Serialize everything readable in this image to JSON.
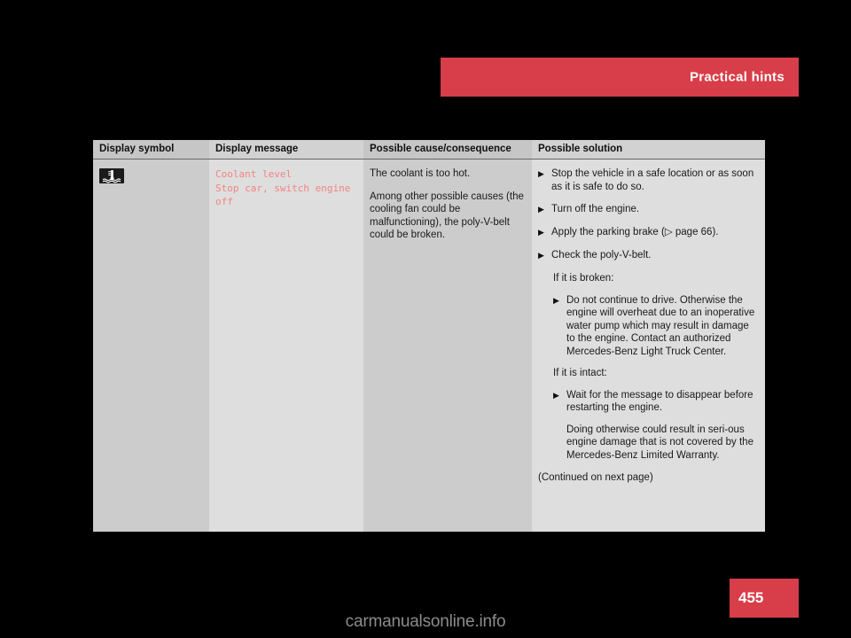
{
  "header": {
    "title": "Practical hints"
  },
  "table": {
    "columns": [
      "Display symbol",
      "Display message",
      "Possible cause/consequence",
      "Possible solution"
    ],
    "row": {
      "symbol_icon": "coolant-temperature-warning-icon",
      "display_message": "Coolant level\nStop car, switch engine\noff",
      "cause": [
        "The coolant is too hot.",
        "Among other possible causes (the cooling fan could be malfunctioning), the poly-V-belt could be broken."
      ],
      "solution": {
        "bullet_glyph": "▶",
        "items": [
          "Stop the vehicle in a safe location or as soon as it is safe to do so.",
          "Turn off the engine.",
          "Apply the parking brake (▷ page 66).",
          "Check the poly-V-belt."
        ],
        "broken_heading": "If it is broken:",
        "broken_items": [
          "Do not continue to drive. Otherwise the engine will overheat due to an inoperative water pump which may result in damage to the engine. Contact an authorized Mercedes-Benz Light Truck Center."
        ],
        "intact_heading": "If it is intact:",
        "intact_items": [
          "Wait for the message to disappear before restarting the engine."
        ],
        "intact_note": "Doing otherwise could result in seri-ous engine damage that is not covered by the Mercedes-Benz Limited Warranty.",
        "continued_note": "(Continued on next page)"
      }
    }
  },
  "page_number": "455",
  "watermark": "carmanualsonline.info",
  "colors": {
    "accent_red": "#d83e49",
    "lcd_message": "#f4837f",
    "header_cell": "#c6c6c6",
    "cell_dark": "#cccccc",
    "cell_light": "#dedede"
  }
}
